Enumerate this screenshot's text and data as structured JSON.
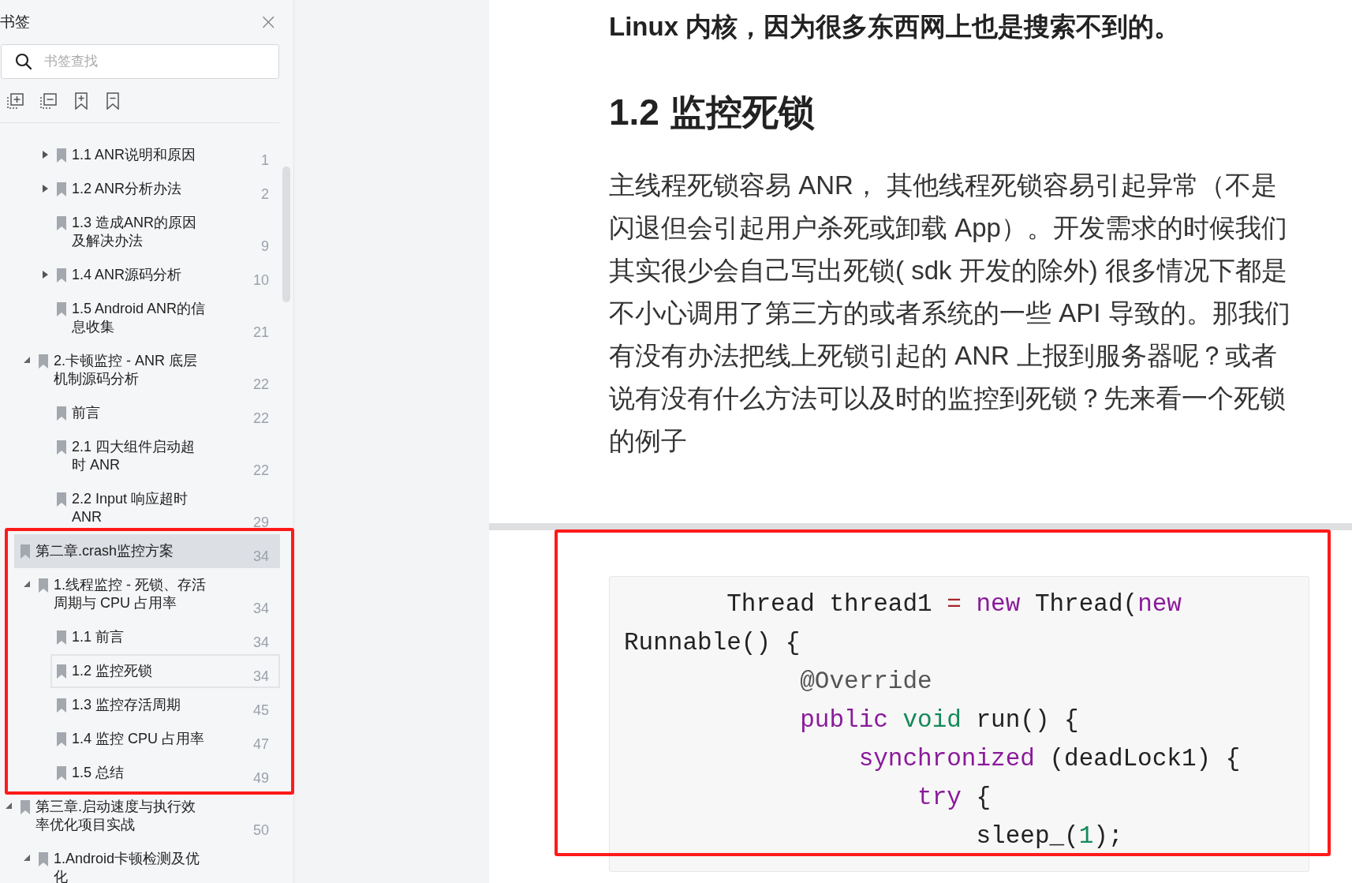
{
  "sidebar": {
    "title": "书签",
    "close": "×",
    "search": {
      "placeholder": "书签查找"
    },
    "tree": [
      {
        "children": [
          {
            "children": [
              {
                "label": "1.1 ANR说明和原因",
                "page": "1",
                "expanded": false,
                "selected": false,
                "focused": false
              },
              {
                "label": "1.2 ANR分析办法",
                "page": "2",
                "expanded": false,
                "selected": false,
                "focused": false
              },
              {
                "label": "1.3 造成ANR的原因及解决办法",
                "page": "9",
                "selected": false,
                "focused": false
              },
              {
                "label": "1.4 ANR源码分析",
                "page": "10",
                "expanded": false,
                "selected": false,
                "focused": false
              },
              {
                "label": "1.5 Android ANR的信息收集",
                "page": "21",
                "selected": false,
                "focused": false
              }
            ]
          },
          {
            "label": "2.卡顿监控 - ANR 底层机制源码分析",
            "page": "22",
            "expanded": true,
            "selected": false,
            "focused": false,
            "children": [
              {
                "label": "前言",
                "page": "22",
                "selected": false,
                "focused": false
              },
              {
                "label": "2.1 四大组件启动超时 ANR",
                "page": "22",
                "selected": false,
                "focused": false
              },
              {
                "label": "2.2 Input 响应超时 ANR",
                "page": "29",
                "selected": false,
                "focused": false
              }
            ]
          }
        ]
      },
      {
        "label": "第二章.crash监控方案",
        "page": "34",
        "selected": true,
        "focused": false,
        "children": [
          {
            "label": "1.线程监控 - 死锁、存活周期与 CPU 占用率",
            "page": "34",
            "expanded": true,
            "selected": false,
            "focused": false,
            "children": [
              {
                "label": "1.1 前言",
                "page": "34",
                "selected": false,
                "focused": false
              },
              {
                "label": "1.2 监控死锁",
                "page": "34",
                "selected": false,
                "focused": true
              },
              {
                "label": "1.3 监控存活周期",
                "page": "45",
                "selected": false,
                "focused": false
              },
              {
                "label": "1.4 监控 CPU 占用率",
                "page": "47",
                "selected": false,
                "focused": false
              },
              {
                "label": "1.5 总结",
                "page": "49",
                "selected": false,
                "focused": false
              }
            ]
          }
        ]
      },
      {
        "label": "第三章.启动速度与执行效率优化项目实战",
        "page": "50",
        "expanded": true,
        "selected": false,
        "focused": false,
        "children": [
          {
            "label": "1.Android卡顿检测及优化",
            "expanded": true,
            "selected": false,
            "focused": false
          }
        ]
      }
    ]
  },
  "document": {
    "pages": [
      {
        "blocks": [
          {
            "kind": "bold_text",
            "text": "Linux 内核，因为很多东西网上也是搜索不到的。"
          },
          {
            "kind": "heading",
            "text": "1.2 监控死锁"
          },
          {
            "kind": "paragraph",
            "text": "主线程死锁容易 ANR， 其他线程死锁容易引起异常（不是闪退但会引起用户杀死或卸载 App）。开发需求的时候我们其实很少会自己写出死锁( sdk 开发的除外) 很多情况下都是不小心调用了第三方的或者系统的一些 API 导致的。那我们有没有办法把线上死锁引起的 ANR 上报到服务器呢？或者说有没有什么方法可以及时的监控到死锁？先来看一个死锁的例子"
          }
        ]
      },
      {
        "blocks": [
          {
            "kind": "code",
            "lines": [
              [
                {
                  "text": "       Thread thread1 ",
                  "kind": "plain"
                },
                {
                  "text": "=",
                  "kind": "operator"
                },
                {
                  "text": " new",
                  "kind": "keyword"
                },
                {
                  "text": " Thread(",
                  "kind": "plain"
                },
                {
                  "text": "new",
                  "kind": "keyword"
                }
              ],
              [
                {
                  "text": "Runnable() {",
                  "kind": "plain"
                }
              ],
              [
                {
                  "text": "            @Override",
                  "kind": "annotation"
                }
              ],
              [
                {
                  "text": "            public",
                  "kind": "keyword"
                },
                {
                  "text": " void",
                  "kind": "type"
                },
                {
                  "text": " run() {",
                  "kind": "plain"
                }
              ],
              [
                {
                  "text": "                synchronized",
                  "kind": "keyword"
                },
                {
                  "text": " (deadLock1) {",
                  "kind": "plain"
                }
              ],
              [
                {
                  "text": "                    try",
                  "kind": "keyword"
                },
                {
                  "text": " {",
                  "kind": "plain"
                }
              ],
              [
                {
                  "text": "                        sleep_(",
                  "kind": "plain"
                },
                {
                  "text": "1",
                  "kind": "number"
                },
                {
                  "text": ");",
                  "kind": "plain"
                }
              ]
            ]
          }
        ]
      }
    ]
  }
}
